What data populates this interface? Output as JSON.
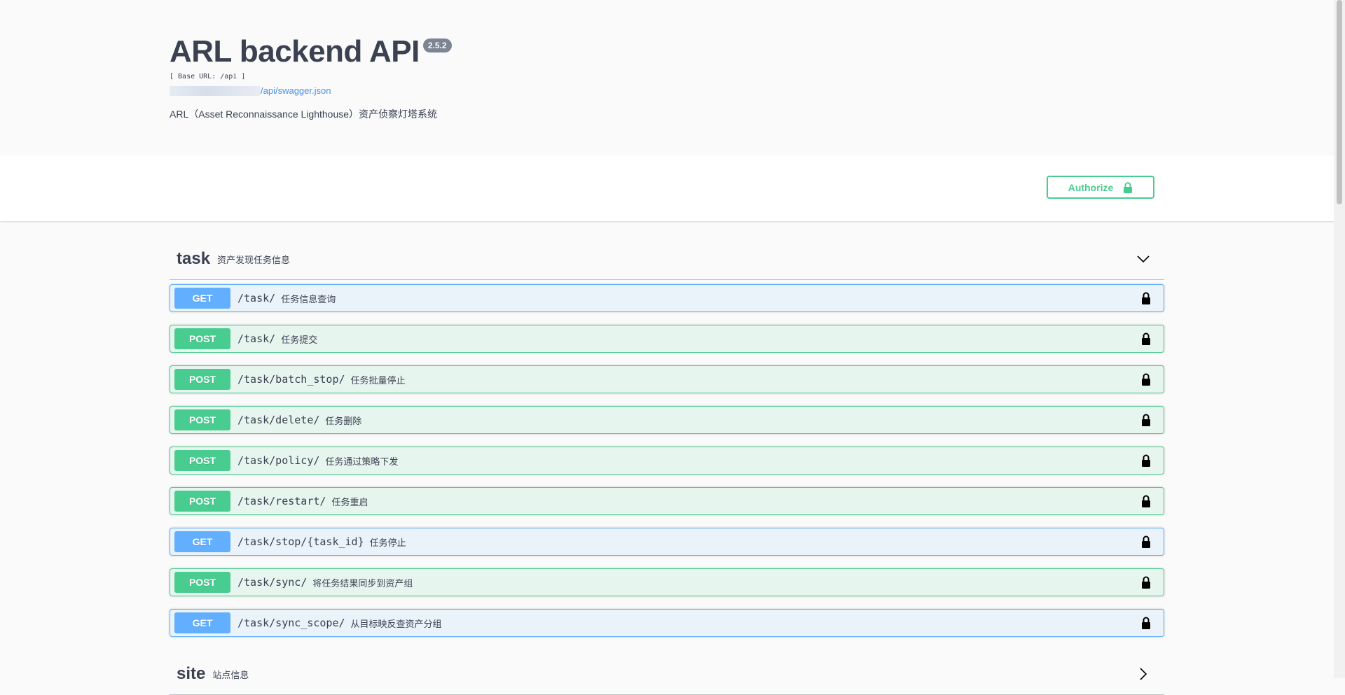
{
  "info": {
    "title": "ARL backend API",
    "version": "2.5.2",
    "base_url": "[ Base URL: /api ]",
    "spec_link": "/api/swagger.json",
    "description": "ARL（Asset Reconnaissance Lighthouse）资产侦察灯塔系统"
  },
  "authorize": {
    "label": "Authorize"
  },
  "tags": [
    {
      "name": "task",
      "description": "资产发现任务信息",
      "expanded": true,
      "operations": [
        {
          "method": "GET",
          "path": "/task/",
          "summary": "任务信息查询"
        },
        {
          "method": "POST",
          "path": "/task/",
          "summary": "任务提交"
        },
        {
          "method": "POST",
          "path": "/task/batch_stop/",
          "summary": "任务批量停止"
        },
        {
          "method": "POST",
          "path": "/task/delete/",
          "summary": "任务删除"
        },
        {
          "method": "POST",
          "path": "/task/policy/",
          "summary": "任务通过策略下发"
        },
        {
          "method": "POST",
          "path": "/task/restart/",
          "summary": "任务重启"
        },
        {
          "method": "GET",
          "path": "/task/stop/{task_id}",
          "summary": "任务停止"
        },
        {
          "method": "POST",
          "path": "/task/sync/",
          "summary": "将任务结果同步到资产组"
        },
        {
          "method": "GET",
          "path": "/task/sync_scope/",
          "summary": "从目标映反查资产分组"
        }
      ]
    },
    {
      "name": "site",
      "description": "站点信息",
      "expanded": false
    }
  ],
  "colors": {
    "get": "#61affe",
    "post": "#49cc90",
    "text": "#3b4151"
  },
  "icons": {
    "lock": "lock-icon",
    "chevron_down": "chevron-down-icon",
    "chevron_right": "chevron-right-icon"
  }
}
